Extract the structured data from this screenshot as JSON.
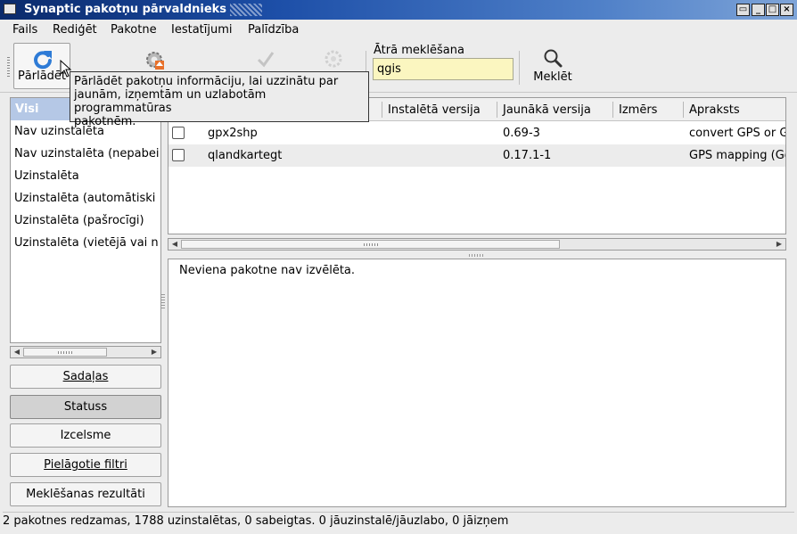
{
  "window": {
    "title": "Synaptic pakotņu pārvaldnieks",
    "controls": [
      "_",
      "□",
      "×",
      "▭"
    ]
  },
  "menubar": {
    "items": [
      "Fails",
      "Rediģēt",
      "Pakotne",
      "Iestatījumi",
      "Palīdzība"
    ]
  },
  "toolbar": {
    "reload_label": "Pārlādēt",
    "search_caption": "Ātrā meklēšana",
    "search_value": "qgis",
    "search_button_label": "Meklēt"
  },
  "tooltip": {
    "text_line1": "Pārlādēt pakotņu informāciju, lai uzzinātu par",
    "text_line2": "jaunām, izņemtām un uzlabotām programmatūras",
    "text_line3": "pakotnēm."
  },
  "filters": {
    "selected": "Visi",
    "items": [
      "Nav uzinstalēta",
      "Nav uzinstalēta (nepabei",
      "Uzinstalēta",
      "Uzinstalēta (automātiski",
      "Uzinstalēta (pašrocīgi)",
      "Uzinstalēta (vietējā vai n"
    ]
  },
  "side_buttons": {
    "sections": "Sadaļas",
    "status": "Statuss",
    "origin": "Izcelsme",
    "custom": "Pielāgotie filtri",
    "search_results": "Meklēšanas rezultāti"
  },
  "table": {
    "columns": {
      "installed": "Instalētā versija",
      "latest": "Jaunākā versija",
      "size": "Izmērs",
      "description": "Apraksts"
    },
    "rows": [
      {
        "package": "gpx2shp",
        "installed": "",
        "latest": "0.69-3",
        "size": "",
        "description": "convert GPS or G"
      },
      {
        "package": "qlandkartegt",
        "installed": "",
        "latest": "0.17.1-1",
        "size": "",
        "description": "GPS mapping (Go"
      }
    ]
  },
  "details": {
    "text": "Neviena pakotne nav izvēlēta."
  },
  "status": {
    "text": "2 pakotnes redzamas, 1788 uzinstalētas, 0 sabeigtas. 0 jāuzinstalē/jāuzlabo, 0 jāizņem"
  },
  "colors": {
    "titlebar_start": "#0a2a6b",
    "selection": "#b5c8e6",
    "search_bg": "#fbf6c0",
    "reload_icon": "#2e7bd6"
  }
}
